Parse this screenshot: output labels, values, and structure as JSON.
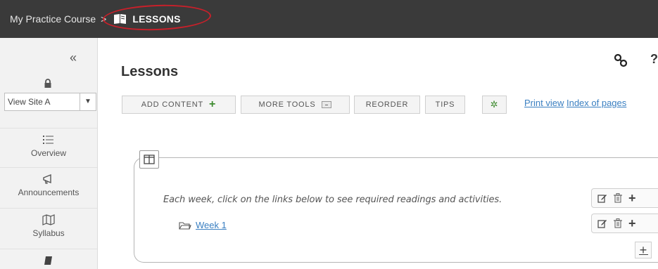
{
  "breadcrumb": {
    "course": "My Practice Course",
    "separator": ">",
    "current": "LESSONS"
  },
  "sidebar": {
    "collapse_glyph": "«",
    "view_site_label": "View Site A",
    "view_site_arrow": "▼",
    "items": [
      {
        "label": "Overview",
        "icon": "list-icon"
      },
      {
        "label": "Announcements",
        "icon": "megaphone-icon"
      },
      {
        "label": "Syllabus",
        "icon": "map-icon"
      },
      {
        "label": "",
        "icon": "book-icon"
      }
    ]
  },
  "main": {
    "title": "Lessons",
    "toolbar": {
      "add_content": "ADD CONTENT",
      "add_content_plus": "+",
      "more_tools": "MORE TOOLS",
      "reorder": "REORDER",
      "tips": "TIPS",
      "settings_glyph": "✲"
    },
    "links": {
      "print_view": "Print view",
      "index_of_pages": "Index of pages"
    },
    "section": {
      "instructions": "Each week, click on the links below to see required readings and activities.",
      "items": [
        {
          "label": "Week 1",
          "icon": "folder-icon"
        }
      ],
      "action_plus": "+",
      "add_plus": "+"
    }
  },
  "colors": {
    "topbar": "#3a3a3a",
    "highlight_ring": "#c8202a",
    "link": "#3a7fc1",
    "accent_green": "#3d8b2f",
    "sidebar_bg": "#f2f2f2"
  }
}
